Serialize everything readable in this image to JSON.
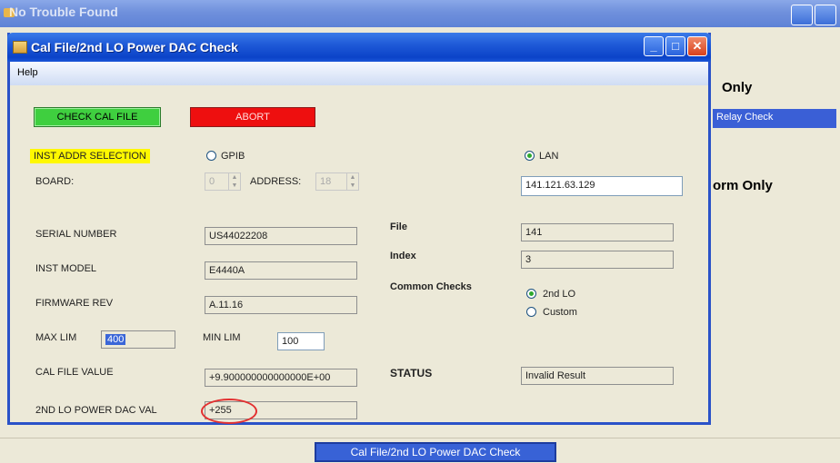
{
  "background_window": {
    "title": "No Trouble Found",
    "text_only": "Only",
    "relay_check": "Relay Check",
    "text_form_only": "orm Only"
  },
  "dialog": {
    "title": "Cal File/2nd LO Power DAC Check",
    "menu": {
      "help": "Help"
    },
    "buttons": {
      "check_cal_file": "CHECK CAL FILE",
      "abort": "ABORT"
    },
    "inst_addr_selection": "INST ADDR SELECTION",
    "gpib": {
      "label": "GPIB",
      "selected": false
    },
    "lan": {
      "label": "LAN",
      "selected": true
    },
    "board_label": "BOARD:",
    "board_value": "0",
    "address_label": "ADDRESS:",
    "address_value": "18",
    "lan_address": "141.121.63.129",
    "serial_number": {
      "label": "SERIAL NUMBER",
      "value": "US44022208"
    },
    "inst_model": {
      "label": "INST MODEL",
      "value": "E4440A"
    },
    "firmware_rev": {
      "label": "FIRMWARE REV",
      "value": "A.11.16"
    },
    "max_lim": {
      "label": "MAX LIM",
      "value": "400"
    },
    "min_lim": {
      "label": "MIN LIM",
      "value": "100"
    },
    "cal_file_value": {
      "label": "CAL FILE VALUE",
      "value": "+9.900000000000000E+00"
    },
    "dac_val": {
      "label": "2ND LO POWER DAC VAL",
      "value": "+255"
    },
    "file": {
      "label": "File",
      "value": "141"
    },
    "index": {
      "label": "Index",
      "value": "3"
    },
    "common_checks": {
      "label": "Common Checks",
      "options": [
        {
          "label": "2nd LO",
          "selected": true
        },
        {
          "label": "Custom",
          "selected": false
        }
      ]
    },
    "status": {
      "label": "STATUS",
      "value": "Invalid Result"
    }
  },
  "taskbar": {
    "button": "Cal File/2nd LO Power DAC Check"
  },
  "colors": {
    "check_button": "#3fcf3f",
    "abort_button": "#ee0f0f",
    "highlight": "#fff800",
    "annotation_circle": "#e33030"
  }
}
